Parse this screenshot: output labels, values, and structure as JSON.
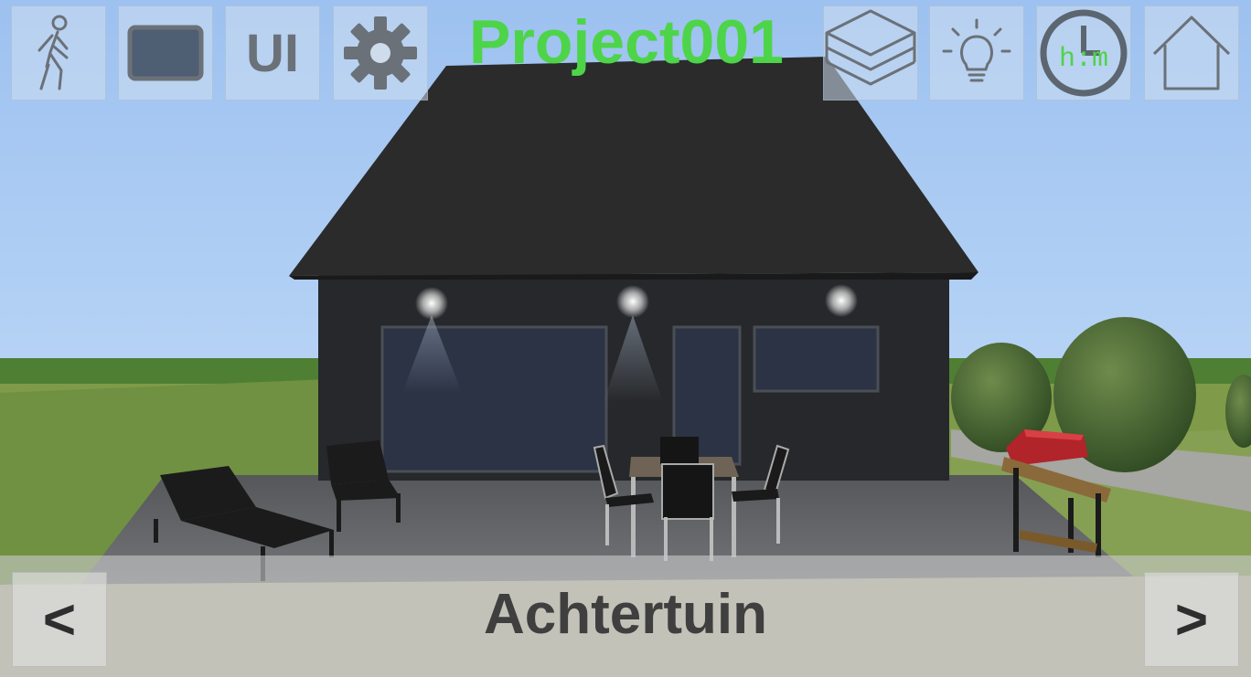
{
  "app": {
    "project_title": "Project001",
    "title_color": "#4ed449"
  },
  "toolbar": {
    "left": [
      {
        "name": "walk",
        "icon": "walking-person-icon"
      },
      {
        "name": "screen",
        "icon": "screen-frame-icon"
      },
      {
        "name": "ui",
        "icon": "ui-toggle-icon",
        "label": "UI"
      },
      {
        "name": "settings",
        "icon": "gear-icon"
      }
    ],
    "right": [
      {
        "name": "layers",
        "icon": "layers-icon"
      },
      {
        "name": "lighting",
        "icon": "lightbulb-icon"
      },
      {
        "name": "time",
        "icon": "clock-icon",
        "label": "h:m"
      },
      {
        "name": "home",
        "icon": "home-icon"
      }
    ]
  },
  "navigation": {
    "prev_label": "<",
    "next_label": ">",
    "current_view": "Achtertuin"
  },
  "colors": {
    "sky": "#a9c9f2",
    "grass": "#5f8a37",
    "house": "#26282b",
    "accent_green": "#4ed449"
  }
}
